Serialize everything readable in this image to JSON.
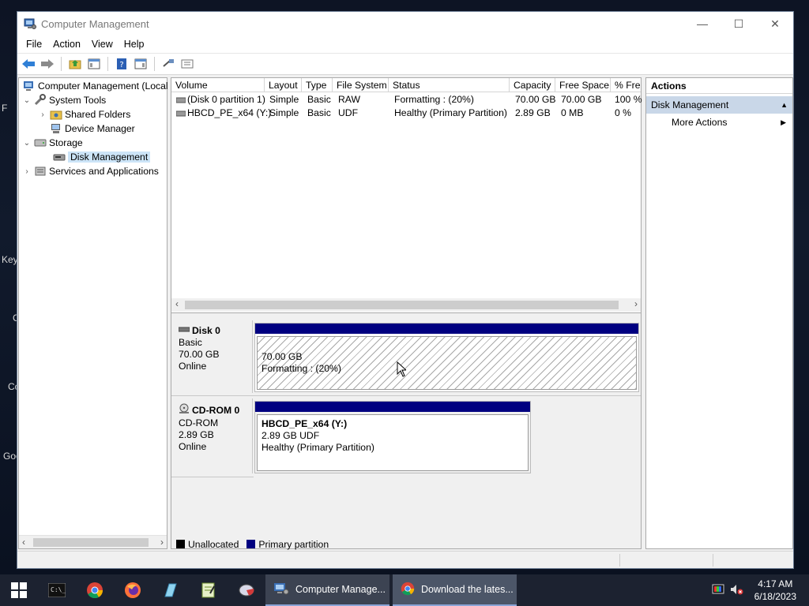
{
  "desktop": {
    "edge_labels": [
      "F",
      "Key",
      "C",
      "Co",
      "Goo"
    ]
  },
  "window": {
    "title": "Computer Management",
    "controls": {
      "minimize": "—",
      "maximize": "☐",
      "close": "✕"
    }
  },
  "menu": [
    "File",
    "Action",
    "View",
    "Help"
  ],
  "tree": {
    "root": "Computer Management (Local",
    "system_tools": "System Tools",
    "shared_folders": "Shared Folders",
    "device_manager": "Device Manager",
    "storage": "Storage",
    "disk_management": "Disk Management",
    "services": "Services and Applications"
  },
  "volumes": {
    "columns": [
      "Volume",
      "Layout",
      "Type",
      "File System",
      "Status",
      "Capacity",
      "Free Space",
      "% Free"
    ],
    "rows": [
      [
        "(Disk 0 partition 1)",
        "Simple",
        "Basic",
        "RAW",
        "Formatting : (20%)",
        "70.00 GB",
        "70.00 GB",
        "100 %"
      ],
      [
        "HBCD_PE_x64 (Y:)",
        "Simple",
        "Basic",
        "UDF",
        "Healthy (Primary Partition)",
        "2.89 GB",
        "0 MB",
        "0 %"
      ]
    ]
  },
  "disks": [
    {
      "name": "Disk 0",
      "type": "Basic",
      "size": "70.00 GB",
      "state": "Online",
      "partition": {
        "line1": "",
        "line2": "70.00 GB",
        "line3": "Formatting : (20%)"
      }
    },
    {
      "name": "CD-ROM 0",
      "type": "CD-ROM",
      "size": "2.89 GB",
      "state": "Online",
      "partition": {
        "line1": "HBCD_PE_x64  (Y:)",
        "line2": "2.89 GB UDF",
        "line3": "Healthy (Primary Partition)"
      }
    }
  ],
  "legend": {
    "unallocated": "Unallocated",
    "primary": "Primary partition"
  },
  "actions": {
    "header": "Actions",
    "section": "Disk Management",
    "more": "More Actions"
  },
  "taskbar": {
    "tasks": [
      "Computer Manage...",
      "Download the lates..."
    ],
    "time": "4:17 AM",
    "date": "6/18/2023"
  },
  "colors": {
    "primary_partition": "#000080",
    "unallocated": "#000000",
    "action_section": "#c9d7e8",
    "selection": "#cce4f7"
  }
}
